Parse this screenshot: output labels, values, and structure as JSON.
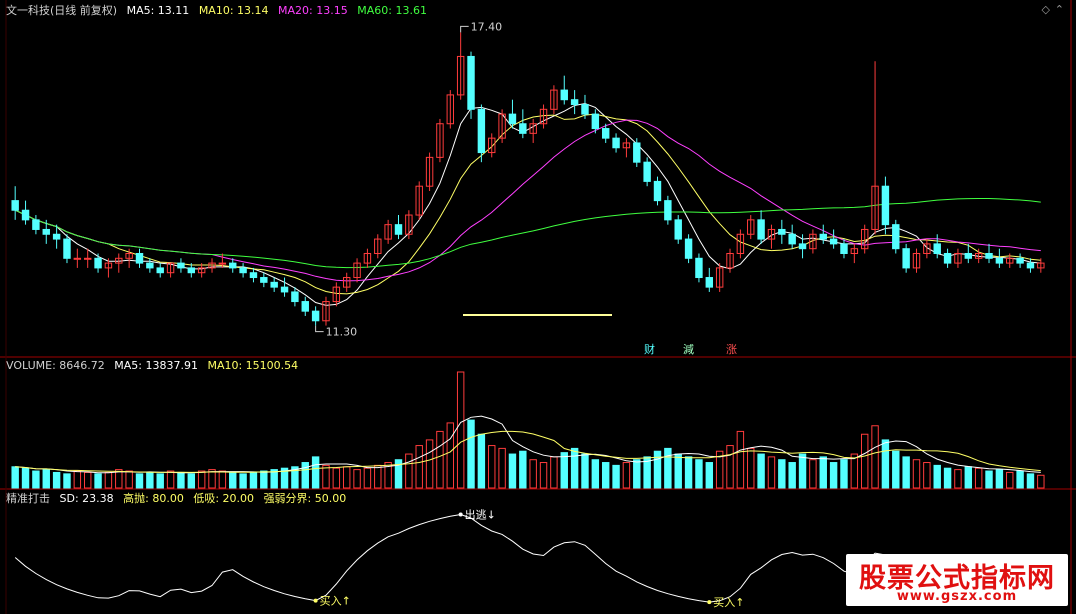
{
  "main": {
    "title": "文一科技(日线 前复权)",
    "ma5": "MA5: 13.11",
    "ma10": "MA10: 13.14",
    "ma20": "MA20: 13.15",
    "ma60": "MA60: 13.61",
    "high_label": "17.40",
    "low_label": "11.30",
    "events": [
      "财",
      "減",
      "涨"
    ],
    "colors": {
      "up": "#ff3c3c",
      "down": "#54ffff",
      "ma5": "#ffffff",
      "ma10": "#ffff66",
      "ma20": "#ff40ff",
      "ma60": "#40ff40",
      "divider": "#a00000"
    }
  },
  "volume": {
    "title": "VOLUME: 8646.72",
    "ma5": "MA5: 13837.91",
    "ma10": "MA10: 15100.54"
  },
  "indicator": {
    "title": "精准打击",
    "sd": "SD: 23.38",
    "high": "高抛: 80.00",
    "low": "低吸: 20.00",
    "mid": "强弱分界: 50.00",
    "sell_signal": "出逃↓",
    "buy_signal": "买入↑"
  },
  "watermark": {
    "title": "股票公式指标网",
    "url": "www.gszx.com"
  },
  "chart_data": {
    "type": "candlestick",
    "title": "文一科技(日线 前复权)",
    "price_range": [
      11.0,
      17.7
    ],
    "candles": [
      [
        13.9,
        14.2,
        13.5,
        13.7
      ],
      [
        13.7,
        13.9,
        13.4,
        13.5
      ],
      [
        13.5,
        13.6,
        13.2,
        13.3
      ],
      [
        13.3,
        13.5,
        13.0,
        13.2
      ],
      [
        13.2,
        13.4,
        12.9,
        13.1
      ],
      [
        13.1,
        13.2,
        12.6,
        12.7
      ],
      [
        12.7,
        12.9,
        12.5,
        12.7
      ],
      [
        12.7,
        12.9,
        12.5,
        12.7
      ],
      [
        12.7,
        12.8,
        12.4,
        12.5
      ],
      [
        12.5,
        12.7,
        12.3,
        12.6
      ],
      [
        12.6,
        12.8,
        12.4,
        12.7
      ],
      [
        12.7,
        12.9,
        12.5,
        12.8
      ],
      [
        12.8,
        12.9,
        12.5,
        12.6
      ],
      [
        12.6,
        12.7,
        12.4,
        12.5
      ],
      [
        12.5,
        12.6,
        12.3,
        12.4
      ],
      [
        12.4,
        12.6,
        12.3,
        12.6
      ],
      [
        12.6,
        12.7,
        12.4,
        12.5
      ],
      [
        12.5,
        12.6,
        12.3,
        12.4
      ],
      [
        12.4,
        12.6,
        12.3,
        12.5
      ],
      [
        12.5,
        12.7,
        12.4,
        12.6
      ],
      [
        12.6,
        12.8,
        12.5,
        12.6
      ],
      [
        12.6,
        12.7,
        12.4,
        12.5
      ],
      [
        12.5,
        12.6,
        12.3,
        12.4
      ],
      [
        12.4,
        12.5,
        12.2,
        12.3
      ],
      [
        12.3,
        12.4,
        12.1,
        12.2
      ],
      [
        12.2,
        12.3,
        12.0,
        12.1
      ],
      [
        12.1,
        12.3,
        11.9,
        12.0
      ],
      [
        12.0,
        12.1,
        11.7,
        11.8
      ],
      [
        11.8,
        11.9,
        11.5,
        11.6
      ],
      [
        11.6,
        11.7,
        11.3,
        11.4
      ],
      [
        11.4,
        11.9,
        11.3,
        11.8
      ],
      [
        11.8,
        12.2,
        11.7,
        12.1
      ],
      [
        12.1,
        12.4,
        12.0,
        12.3
      ],
      [
        12.3,
        12.7,
        12.2,
        12.6
      ],
      [
        12.6,
        12.9,
        12.5,
        12.8
      ],
      [
        12.8,
        13.2,
        12.7,
        13.1
      ],
      [
        13.1,
        13.5,
        13.0,
        13.4
      ],
      [
        13.4,
        13.6,
        13.1,
        13.2
      ],
      [
        13.2,
        13.7,
        13.1,
        13.6
      ],
      [
        13.6,
        14.3,
        13.5,
        14.2
      ],
      [
        14.2,
        14.9,
        14.1,
        14.8
      ],
      [
        14.8,
        15.6,
        14.7,
        15.5
      ],
      [
        15.5,
        16.2,
        15.4,
        16.1
      ],
      [
        16.1,
        17.4,
        16.0,
        16.9
      ],
      [
        16.9,
        17.0,
        15.6,
        15.8
      ],
      [
        15.8,
        15.9,
        14.7,
        14.9
      ],
      [
        14.9,
        15.3,
        14.8,
        15.2
      ],
      [
        15.2,
        15.8,
        15.1,
        15.7
      ],
      [
        15.7,
        16.0,
        15.4,
        15.5
      ],
      [
        15.5,
        15.8,
        15.2,
        15.3
      ],
      [
        15.3,
        15.6,
        15.1,
        15.5
      ],
      [
        15.5,
        15.9,
        15.4,
        15.8
      ],
      [
        15.8,
        16.3,
        15.7,
        16.2
      ],
      [
        16.2,
        16.5,
        15.9,
        16.0
      ],
      [
        16.0,
        16.2,
        15.7,
        15.9
      ],
      [
        15.9,
        16.1,
        15.6,
        15.7
      ],
      [
        15.7,
        15.8,
        15.3,
        15.4
      ],
      [
        15.4,
        15.5,
        15.1,
        15.2
      ],
      [
        15.2,
        15.3,
        14.9,
        15.0
      ],
      [
        15.0,
        15.2,
        14.8,
        15.1
      ],
      [
        15.1,
        15.2,
        14.6,
        14.7
      ],
      [
        14.7,
        14.8,
        14.2,
        14.3
      ],
      [
        14.3,
        14.4,
        13.8,
        13.9
      ],
      [
        13.9,
        14.0,
        13.4,
        13.5
      ],
      [
        13.5,
        13.6,
        13.0,
        13.1
      ],
      [
        13.1,
        13.2,
        12.6,
        12.7
      ],
      [
        12.7,
        12.8,
        12.2,
        12.3
      ],
      [
        12.3,
        12.5,
        12.0,
        12.1
      ],
      [
        12.1,
        12.6,
        12.0,
        12.5
      ],
      [
        12.5,
        12.9,
        12.4,
        12.8
      ],
      [
        12.8,
        13.3,
        12.7,
        13.2
      ],
      [
        13.2,
        13.6,
        13.1,
        13.5
      ],
      [
        13.5,
        13.7,
        13.0,
        13.1
      ],
      [
        13.1,
        13.4,
        12.9,
        13.3
      ],
      [
        13.3,
        13.5,
        13.0,
        13.2
      ],
      [
        13.2,
        13.4,
        12.9,
        13.0
      ],
      [
        13.0,
        13.2,
        12.7,
        12.9
      ],
      [
        12.9,
        13.3,
        12.8,
        13.2
      ],
      [
        13.2,
        13.4,
        13.0,
        13.1
      ],
      [
        13.1,
        13.3,
        12.9,
        13.0
      ],
      [
        13.0,
        13.1,
        12.7,
        12.8
      ],
      [
        12.8,
        13.0,
        12.6,
        12.9
      ],
      [
        12.9,
        13.4,
        12.8,
        13.3
      ],
      [
        13.3,
        16.8,
        13.2,
        14.2
      ],
      [
        14.2,
        14.4,
        13.2,
        13.4
      ],
      [
        13.4,
        13.5,
        12.8,
        12.9
      ],
      [
        12.9,
        13.0,
        12.4,
        12.5
      ],
      [
        12.5,
        12.9,
        12.4,
        12.8
      ],
      [
        12.8,
        13.1,
        12.7,
        13.0
      ],
      [
        13.0,
        13.2,
        12.7,
        12.8
      ],
      [
        12.8,
        12.9,
        12.5,
        12.6
      ],
      [
        12.6,
        12.9,
        12.5,
        12.8
      ],
      [
        12.8,
        13.0,
        12.6,
        12.7
      ],
      [
        12.7,
        12.9,
        12.6,
        12.8
      ],
      [
        12.8,
        13.0,
        12.6,
        12.7
      ],
      [
        12.7,
        12.9,
        12.5,
        12.6
      ],
      [
        12.6,
        12.8,
        12.5,
        12.7
      ],
      [
        12.7,
        12.8,
        12.5,
        12.6
      ],
      [
        12.6,
        12.7,
        12.4,
        12.5
      ],
      [
        12.5,
        12.7,
        12.4,
        12.6
      ]
    ],
    "volume": [
      15,
      14,
      12,
      13,
      11,
      10,
      12,
      11,
      10,
      11,
      13,
      12,
      10,
      11,
      10,
      12,
      11,
      10,
      12,
      13,
      12,
      11,
      10,
      11,
      12,
      13,
      14,
      15,
      18,
      22,
      16,
      14,
      15,
      13,
      14,
      16,
      18,
      20,
      24,
      30,
      34,
      40,
      46,
      82,
      48,
      38,
      30,
      28,
      24,
      26,
      20,
      18,
      22,
      25,
      28,
      24,
      20,
      18,
      16,
      18,
      20,
      22,
      26,
      28,
      24,
      22,
      20,
      18,
      26,
      30,
      40,
      28,
      24,
      22,
      20,
      18,
      24,
      20,
      22,
      18,
      20,
      24,
      38,
      44,
      34,
      26,
      22,
      20,
      18,
      16,
      14,
      13,
      15,
      14,
      12,
      13,
      11,
      12,
      10,
      9
    ],
    "indicator_levels": {
      "high": 80.0,
      "low": 20.0,
      "mid": 50.0,
      "sd": 23.38
    }
  }
}
